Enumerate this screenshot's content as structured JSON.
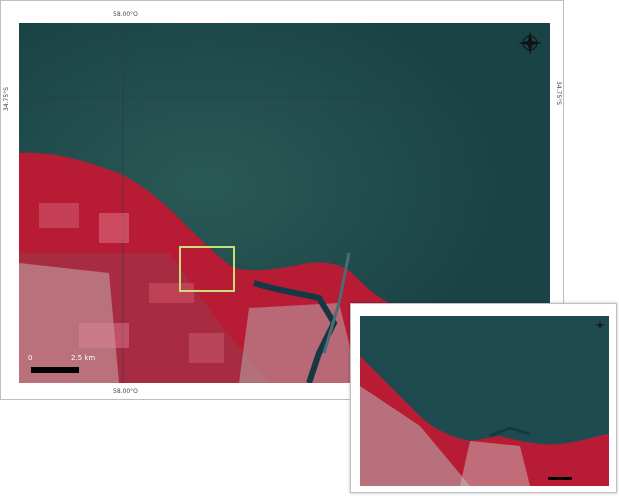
{
  "main_map": {
    "coord_top": "58.00°O",
    "coord_bottom": "58.00°O",
    "coord_left": "34.75°S",
    "coord_right": "34.75°S",
    "compass_icon": "compass-rose-icon",
    "scale_zero": "0",
    "scale_end": "2.5 km",
    "zoom_box_color": "#c9dd7a",
    "water_color": "#1f4a4c",
    "land_color": "#c0203a"
  },
  "inset_map": {
    "compass_icon": "compass-rose-icon"
  }
}
